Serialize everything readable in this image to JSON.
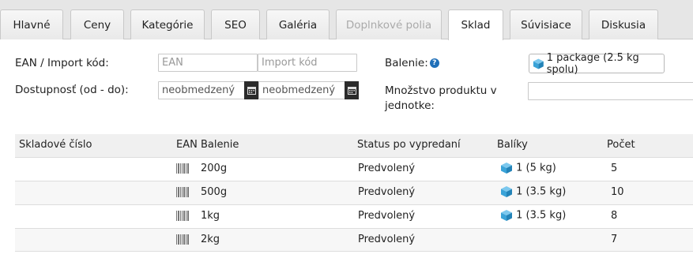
{
  "tabs": [
    {
      "label": "Hlavné",
      "state": "normal"
    },
    {
      "label": "Ceny",
      "state": "normal"
    },
    {
      "label": "Kategórie",
      "state": "normal"
    },
    {
      "label": "SEO",
      "state": "normal"
    },
    {
      "label": "Galéria",
      "state": "normal"
    },
    {
      "label": "Doplnkové polia",
      "state": "disabled"
    },
    {
      "label": "Sklad",
      "state": "active"
    },
    {
      "label": "Súvisiace",
      "state": "normal"
    },
    {
      "label": "Diskusia",
      "state": "normal"
    }
  ],
  "form": {
    "ean_label": "EAN / Import kód:",
    "ean_placeholder": "EAN",
    "import_placeholder": "Import kód",
    "availability_label": "Dostupnosť (od - do):",
    "date_from_value": "neobmedzený",
    "date_to_value": "neobmedzený",
    "package_label": "Balenie:",
    "package_button": "1 package (2.5 kg spolu)",
    "quantity_label_line1": "Množstvo produktu v",
    "quantity_label_line2": "jednotke:"
  },
  "table": {
    "headers": {
      "sku": "Skladové číslo",
      "ean": "EAN",
      "package": "Balenie",
      "status": "Status po vypredaní",
      "parcels": "Balíky",
      "count": "Počet"
    },
    "rows": [
      {
        "package": "200g",
        "status": "Predvolený",
        "parcels": "1 (5 kg)",
        "count": "5"
      },
      {
        "package": "500g",
        "status": "Predvolený",
        "parcels": "1 (3.5 kg)",
        "count": "10"
      },
      {
        "package": "1kg",
        "status": "Predvolený",
        "parcels": "1 (3.5 kg)",
        "count": "8"
      },
      {
        "package": "2kg",
        "status": "Predvolený",
        "parcels": "",
        "count": "7"
      }
    ]
  },
  "colors": {
    "cube": "#3aa3d8",
    "help": "#1f6fb8"
  }
}
